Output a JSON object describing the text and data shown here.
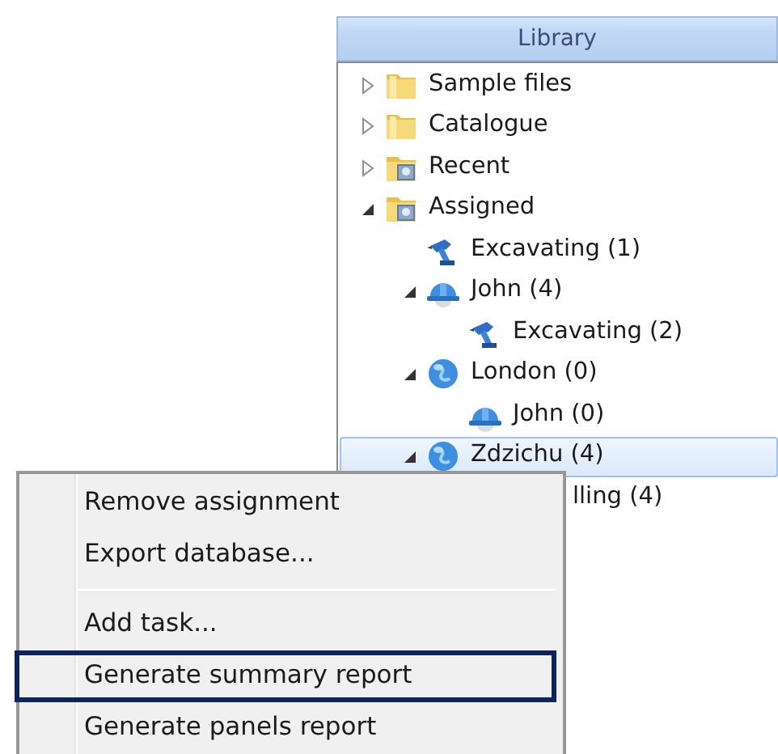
{
  "library": {
    "title": "Library",
    "tree": [
      {
        "label": "Sample files",
        "kind": "folder",
        "expanded": false,
        "selected": false
      },
      {
        "label": "Catalogue",
        "kind": "folder",
        "expanded": false,
        "selected": false
      },
      {
        "label": "Recent",
        "kind": "special_folder",
        "expanded": false,
        "selected": false
      },
      {
        "label": "Assigned",
        "kind": "special_folder",
        "expanded": true,
        "selected": false,
        "children": [
          {
            "label": "Excavating (1)",
            "kind": "drill",
            "selected": false
          },
          {
            "label": "John (4)",
            "kind": "worker",
            "expanded": true,
            "selected": false,
            "children": [
              {
                "label": "Excavating (2)",
                "kind": "drill",
                "selected": false
              }
            ]
          },
          {
            "label": "London (0)",
            "kind": "globe",
            "expanded": true,
            "selected": false,
            "children": [
              {
                "label": "John (0)",
                "kind": "worker",
                "selected": false
              }
            ]
          },
          {
            "label": "Zdzichu (4)",
            "kind": "globe",
            "expanded": true,
            "selected": true,
            "children": [
              {
                "label": "lling (4)",
                "kind": "hidden",
                "selected": false
              }
            ]
          }
        ]
      }
    ]
  },
  "context_menu": {
    "items": [
      {
        "kind": "item",
        "label": "Remove assignment",
        "selected": false
      },
      {
        "kind": "item",
        "label": "Export database...",
        "selected": false
      },
      {
        "kind": "separator"
      },
      {
        "kind": "item",
        "label": "Add task...",
        "selected": false
      },
      {
        "kind": "item",
        "label": "Generate summary report",
        "selected": true
      },
      {
        "kind": "item",
        "label": "Generate panels report",
        "selected": false
      }
    ]
  }
}
